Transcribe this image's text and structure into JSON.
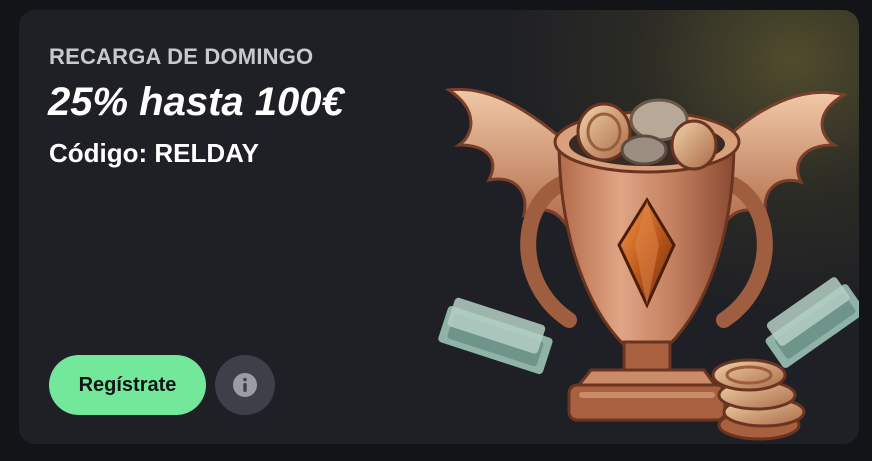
{
  "promo": {
    "eyebrow": "RECARGA DE DOMINGO",
    "headline": "25% hasta 100€",
    "code": "Código: RELDAY",
    "cta_label": "Regístrate",
    "info_icon": "info-icon",
    "illustration_icon": "trophy-icon"
  },
  "colors": {
    "card_bg": "#1f2025",
    "cta_bg": "#74e89a",
    "info_bg": "#3e4049",
    "text_primary": "#ffffff",
    "text_secondary": "#c8c9cf"
  }
}
